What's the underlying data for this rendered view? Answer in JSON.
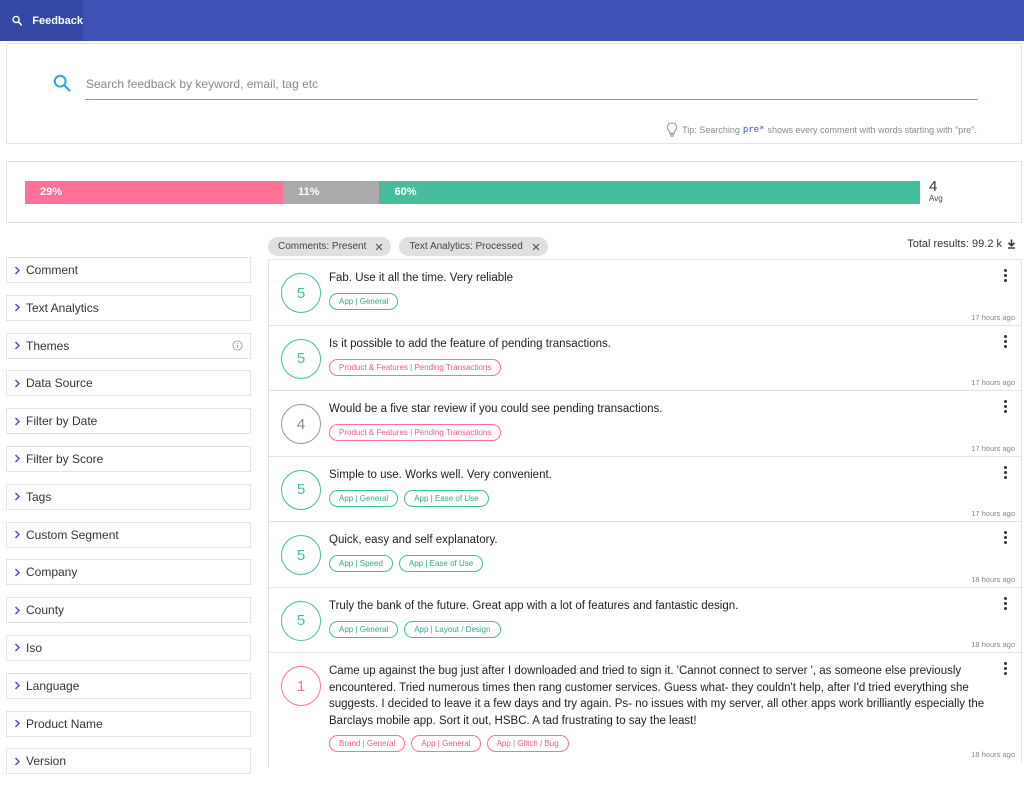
{
  "topbar": {
    "tab_label": "Feedback",
    "tab_icon": "search-icon"
  },
  "search": {
    "placeholder": "Search feedback by keyword, email, tag etc",
    "value": "",
    "tip_prefix": "Tip: Searching",
    "tip_code": "pre*",
    "tip_suffix": "shows every comment with words starting with \"pre\"."
  },
  "scores": {
    "negative": {
      "label": "29%",
      "percent": 29,
      "color": "#ff7196"
    },
    "neutral": {
      "label": "11%",
      "percent": 11,
      "color": "#aaaaaa"
    },
    "positive": {
      "label": "60%",
      "percent": 60,
      "color": "#46bd9d"
    },
    "avg_value": "4",
    "avg_label": "Avg"
  },
  "sidebar": {
    "items": [
      {
        "label": "Comment"
      },
      {
        "label": "Text Analytics"
      },
      {
        "label": "Themes",
        "info": true
      },
      {
        "label": "Data Source"
      },
      {
        "label": "Filter by Date"
      },
      {
        "label": "Filter by Score"
      },
      {
        "label": "Tags"
      },
      {
        "label": "Custom Segment"
      },
      {
        "label": "Company"
      },
      {
        "label": "County"
      },
      {
        "label": "Iso"
      },
      {
        "label": "Language"
      },
      {
        "label": "Product Name"
      },
      {
        "label": "Version"
      }
    ]
  },
  "filters": {
    "chips": [
      {
        "label": "Comments: Present"
      },
      {
        "label": "Text Analytics: Processed"
      }
    ],
    "total_label": "Total results: 99.2 k"
  },
  "feed": {
    "items": [
      {
        "score": "5",
        "sentiment": "positive",
        "comment": "Fab. Use it all the time. Very reliable",
        "tags": [
          {
            "label": "App | General",
            "color": "green"
          }
        ],
        "time": "17 hours ago"
      },
      {
        "score": "5",
        "sentiment": "positive",
        "comment": "Is it possible to add the feature of pending transactions.",
        "tags": [
          {
            "label": "Product & Features | Pending Transactions",
            "color": "pink"
          }
        ],
        "time": "17 hours ago"
      },
      {
        "score": "4",
        "sentiment": "neutral",
        "comment": "Would be a five star review if you could see pending transactions.",
        "tags": [
          {
            "label": "Product & Features | Pending Transactions",
            "color": "pink"
          }
        ],
        "time": "17 hours ago"
      },
      {
        "score": "5",
        "sentiment": "positive",
        "comment": "Simple to use. Works well. Very convenient.",
        "tags": [
          {
            "label": "App | General",
            "color": "green"
          },
          {
            "label": "App | Ease of Use",
            "color": "green"
          }
        ],
        "time": "17 hours ago"
      },
      {
        "score": "5",
        "sentiment": "positive",
        "comment": "Quick, easy and self explanatory.",
        "tags": [
          {
            "label": "App | Speed",
            "color": "green"
          },
          {
            "label": "App | Ease of Use",
            "color": "green"
          }
        ],
        "time": "18 hours ago"
      },
      {
        "score": "5",
        "sentiment": "positive",
        "comment": "Truly the bank of the future. Great app with a lot of features and fantastic design.",
        "tags": [
          {
            "label": "App | General",
            "color": "green"
          },
          {
            "label": "App | Layout / Design",
            "color": "green"
          }
        ],
        "time": "18 hours ago"
      },
      {
        "score": "1",
        "sentiment": "negative",
        "comment": "Came up against the bug just after I downloaded and tried to sign it. 'Cannot connect to server ', as someone else previously encountered. Tried numerous times then rang customer services. Guess what- they couldn't help, after I'd tried everything she suggests. I decided to leave it a few days and try again. Ps- no issues with my server, all other apps work brilliantly especially the Barclays mobile app. Sort it out, HSBC. A tad frustrating to say the least!",
        "tags": [
          {
            "label": "Brand | General",
            "color": "pink"
          },
          {
            "label": "App | General",
            "color": "pink"
          },
          {
            "label": "App | Glitch / Bug",
            "color": "pink"
          }
        ],
        "time": "18 hours ago"
      }
    ]
  }
}
